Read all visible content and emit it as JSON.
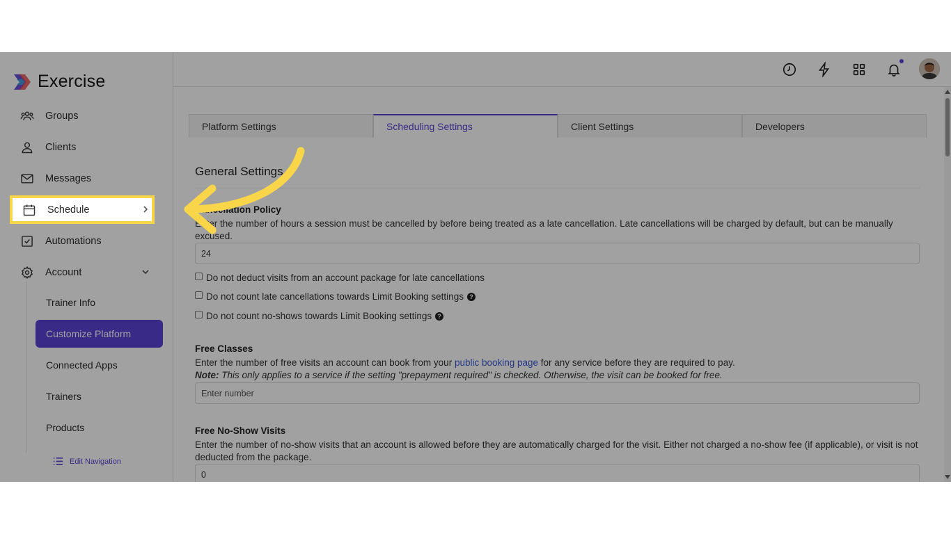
{
  "app": {
    "name": "Exercise"
  },
  "sidebar": {
    "items": [
      {
        "label": "Groups",
        "icon": "groups-icon"
      },
      {
        "label": "Clients",
        "icon": "user-icon"
      },
      {
        "label": "Messages",
        "icon": "mail-icon"
      },
      {
        "label": "Schedule",
        "icon": "calendar-icon"
      },
      {
        "label": "Automations",
        "icon": "checkbox-icon"
      },
      {
        "label": "Account",
        "icon": "gear-icon"
      }
    ],
    "account_subitems": [
      {
        "label": "Trainer Info"
      },
      {
        "label": "Customize Platform",
        "active": true
      },
      {
        "label": "Connected Apps"
      },
      {
        "label": "Trainers"
      },
      {
        "label": "Products"
      }
    ],
    "edit_navigation_label": "Edit Navigation"
  },
  "topbar": {
    "icons": [
      "clock-icon",
      "bolt-icon",
      "apps-grid-icon",
      "bell-icon",
      "avatar"
    ]
  },
  "tabs": [
    {
      "label": "Platform Settings"
    },
    {
      "label": "Scheduling Settings",
      "active": true
    },
    {
      "label": "Client Settings"
    },
    {
      "label": "Developers"
    }
  ],
  "general": {
    "title": "General Settings",
    "cancellation": {
      "title": "Cancellation Policy",
      "description": "Enter the number of hours a session must be cancelled by before being treated as a late cancellation. Late cancellations will be charged by default, but can be manually excused.",
      "value": "24",
      "checkboxes": [
        {
          "label": "Do not deduct visits from an account package for late cancellations",
          "help": false
        },
        {
          "label": "Do not count late cancellations towards Limit Booking settings",
          "help": true
        },
        {
          "label": "Do not count no-shows towards Limit Booking settings",
          "help": true
        }
      ]
    },
    "free_classes": {
      "title": "Free Classes",
      "description_before": "Enter the number of free visits an account can book from your ",
      "link": "public booking page",
      "description_after": " for any service before they are required to pay.",
      "note_label": "Note:",
      "note": " This only applies to a service if the setting \"prepayment required\" is checked. Otherwise, the visit can be booked for free.",
      "placeholder": "Enter number"
    },
    "free_noshow": {
      "title": "Free No-Show Visits",
      "description": "Enter the number of no-show visits that an account is allowed before they are automatically charged for the visit. Either not charged a no-show fee (if applicable), or visit is not deducted from the package.",
      "value": "0"
    }
  },
  "colors": {
    "accent": "#5b43d6",
    "highlight": "#f9d54a",
    "link": "#3c5ad6"
  }
}
